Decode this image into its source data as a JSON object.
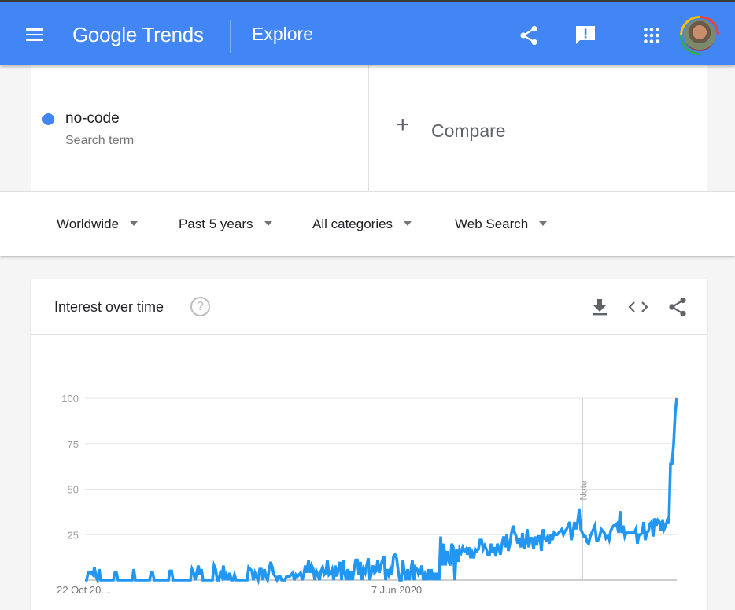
{
  "header": {
    "logo": "Google Trends",
    "section": "Explore",
    "icons": [
      "menu-icon",
      "share-icon",
      "feedback-icon",
      "apps-icon",
      "avatar"
    ]
  },
  "search": {
    "term": "no-code",
    "term_type": "Search term",
    "term_color": "#4285f4",
    "compare_label": "Compare"
  },
  "filters": [
    {
      "label": "Worldwide"
    },
    {
      "label": "Past 5 years"
    },
    {
      "label": "All categories"
    },
    {
      "label": "Web Search"
    }
  ],
  "card": {
    "title": "Interest over time",
    "help": "?",
    "actions": [
      "download-icon",
      "embed-icon",
      "share-icon"
    ]
  },
  "chart_data": {
    "type": "line",
    "title": "Interest over time",
    "series": [
      {
        "name": "no-code",
        "color": "#2196f3",
        "values": [
          0,
          0,
          4,
          4,
          4,
          3,
          7,
          2,
          0,
          6,
          0,
          0,
          0,
          0,
          0,
          0,
          0,
          0,
          0,
          4,
          4,
          0,
          0,
          0,
          0,
          0,
          0,
          0,
          0,
          0,
          0,
          6,
          0,
          0,
          0,
          0,
          0,
          0,
          0,
          0,
          0,
          0,
          4,
          4,
          0,
          0,
          0,
          0,
          0,
          0,
          0,
          0,
          0,
          0,
          5,
          5,
          0,
          0,
          0,
          0,
          0,
          0,
          0,
          0,
          0,
          0,
          0,
          0,
          6,
          4,
          0,
          4,
          8,
          3,
          6,
          0,
          0,
          0,
          0,
          0,
          0,
          0,
          8,
          6,
          0,
          0,
          4,
          2,
          8,
          0,
          3,
          0,
          4,
          0,
          0,
          3,
          0,
          0,
          0,
          0,
          0,
          0,
          0,
          0,
          7,
          6,
          5,
          0,
          4,
          2,
          0,
          6,
          6,
          0,
          6,
          2,
          0,
          6,
          10,
          7,
          3,
          2,
          0,
          2,
          2,
          0,
          0,
          0,
          2,
          2,
          2,
          3,
          4,
          0,
          3,
          2,
          3,
          4,
          0,
          3,
          8,
          4,
          11,
          4,
          8,
          6,
          0,
          5,
          3,
          0,
          5,
          7,
          3,
          4,
          11,
          3,
          4,
          6,
          0,
          8,
          2,
          6,
          10,
          0,
          11,
          4,
          0,
          6,
          0,
          5,
          0,
          6,
          11,
          11,
          3,
          10,
          0,
          6,
          4,
          8,
          12,
          0,
          4,
          8,
          4,
          5,
          11,
          4,
          8,
          11,
          13,
          0,
          6,
          3,
          6,
          3,
          13,
          14,
          12,
          5,
          0,
          0,
          11,
          4,
          0,
          6,
          0,
          5,
          11,
          0,
          7,
          6,
          3,
          4,
          8,
          0,
          3,
          0,
          6,
          0,
          6,
          0,
          4,
          0,
          4,
          0,
          24,
          8,
          20,
          8,
          16,
          11,
          8,
          20,
          18,
          0,
          17,
          10,
          17,
          15,
          18,
          16,
          17,
          14,
          18,
          12,
          15,
          12,
          17,
          16,
          17,
          22,
          22,
          17,
          19,
          17,
          14,
          14,
          20,
          15,
          18,
          13,
          20,
          17,
          14,
          20,
          24,
          18,
          25,
          16,
          20,
          26,
          30,
          26,
          24,
          20,
          23,
          18,
          26,
          17,
          20,
          28,
          18,
          23,
          23,
          17,
          24,
          19,
          24,
          24,
          16,
          28,
          23,
          22,
          24,
          20,
          25,
          22,
          26,
          25,
          25,
          26,
          27,
          28,
          25,
          27,
          28,
          30,
          32,
          22,
          26,
          32,
          28,
          32,
          39,
          28,
          26,
          24,
          24,
          21,
          20,
          24,
          26,
          28,
          30,
          22,
          22,
          24,
          28,
          27,
          26,
          23,
          24,
          22,
          27,
          29,
          30,
          30,
          31,
          26,
          38,
          26,
          30,
          24,
          26,
          26,
          26,
          26,
          26,
          26,
          28,
          20,
          25,
          25,
          26,
          32,
          22,
          26,
          27,
          31,
          32,
          24,
          34,
          30,
          33,
          32,
          27,
          33,
          28,
          30,
          33,
          31,
          64,
          64,
          75,
          92,
          100
        ]
      }
    ],
    "x_tick_labels": [
      "22 Oct 20...",
      "7 Jun 2020"
    ],
    "y_ticks": [
      0,
      25,
      50,
      75,
      100
    ],
    "y_tick_labels": [
      "",
      "25",
      "50",
      "75",
      "100"
    ],
    "ylim": [
      0,
      100
    ],
    "annotations": [
      {
        "label": "Note",
        "position_fraction": 0.841
      }
    ],
    "grid": true,
    "xlabel": "",
    "ylabel": ""
  }
}
